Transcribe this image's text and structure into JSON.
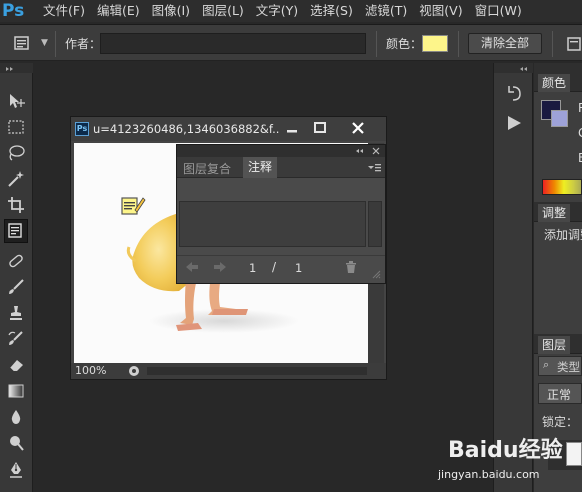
{
  "app": {
    "logo": "Ps"
  },
  "menu": [
    "文件(F)",
    "编辑(E)",
    "图像(I)",
    "图层(L)",
    "文字(Y)",
    "选择(S)",
    "滤镜(T)",
    "视图(V)",
    "窗口(W)"
  ],
  "options_bar": {
    "tool_icon": "note-tool-icon",
    "author_label": "作者：",
    "author_value": "",
    "color_label": "颜色：",
    "color_value": "#fdf58a",
    "clear_all_label": "清除全部"
  },
  "tools": [
    "move-tool-icon",
    "marquee-tool-icon",
    "lasso-tool-icon",
    "magic-wand-tool-icon",
    "crop-tool-icon",
    "note-tool-icon",
    "healing-brush-tool-icon",
    "brush-tool-icon",
    "clone-stamp-tool-icon",
    "history-brush-tool-icon",
    "eraser-tool-icon",
    "gradient-tool-icon",
    "blur-tool-icon",
    "dodge-tool-icon",
    "pen-tool-icon"
  ],
  "document": {
    "title": "u=4123260486,1346036882&f...",
    "zoom": "100%"
  },
  "notes_panel": {
    "tab_layer_comps": "图层复合",
    "tab_notes": "注释",
    "current": "1",
    "separator": "/",
    "total": "1"
  },
  "right_panels": {
    "color_tab": "颜色",
    "color_letters": [
      "R",
      "G",
      "B"
    ],
    "adjust_tab": "调整",
    "adjust_text": "添加调整",
    "layers_tab": "图层",
    "layers_search": "类型",
    "blend_mode": "正常",
    "lock_label": "锁定："
  },
  "watermark": {
    "brand": "Baidu经验",
    "url": "jingyan.baidu.com"
  }
}
